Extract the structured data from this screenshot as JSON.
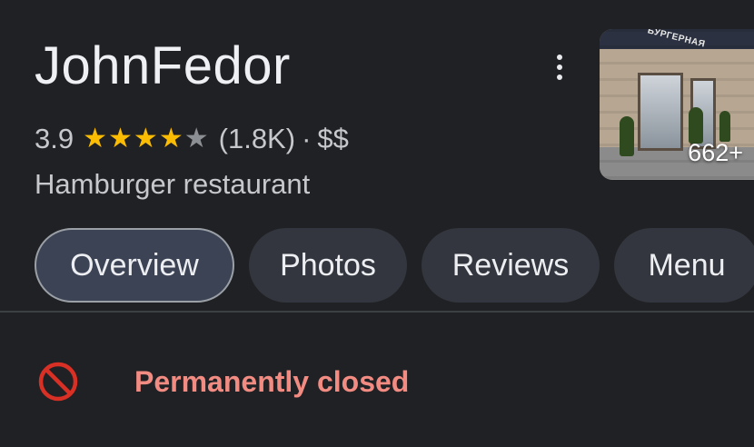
{
  "place": {
    "name": "JohnFedor",
    "rating": "3.9",
    "stars": {
      "filled": 4,
      "total": 5
    },
    "review_count": "(1.8K)",
    "separator": "·",
    "price": "$$",
    "category": "Hamburger restaurant"
  },
  "photo": {
    "count_label": "662+",
    "sign_text": "БУРГЕРНАЯ"
  },
  "tabs": [
    {
      "label": "Overview",
      "active": true
    },
    {
      "label": "Photos",
      "active": false
    },
    {
      "label": "Reviews",
      "active": false
    },
    {
      "label": "Menu",
      "active": false
    }
  ],
  "status": {
    "text": "Permanently closed",
    "icon": "block-icon",
    "color": "#f28b82"
  },
  "colors": {
    "background": "#202124",
    "star_on": "#fbbc04",
    "star_off": "#8c8f94",
    "tab_bg": "#33363e",
    "tab_active_bg": "#3c4354"
  }
}
